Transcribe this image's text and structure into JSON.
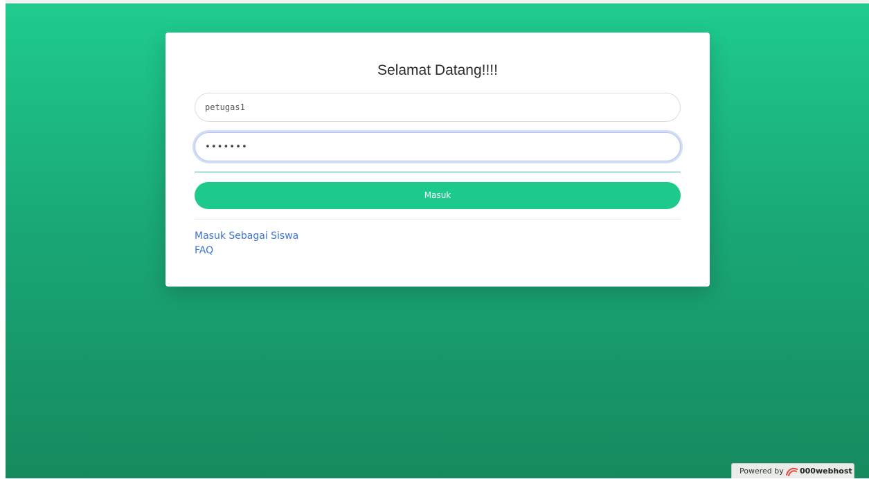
{
  "login": {
    "title": "Selamat Datang!!!!",
    "username_value": "petugas1",
    "password_mask": "•••••••",
    "submit_label": "Masuk"
  },
  "links": {
    "student_login": "Masuk Sebagai Siswa",
    "faq": "FAQ"
  },
  "footer": {
    "powered_by": "Powered by",
    "brand": "000webhost"
  },
  "icons": {
    "brand_logo": "000webhost-logo-icon"
  },
  "colors": {
    "accent": "#1ec98c",
    "link": "#3b74d1",
    "background_top": "#1fcc8d",
    "background_bottom": "#168a5e"
  }
}
